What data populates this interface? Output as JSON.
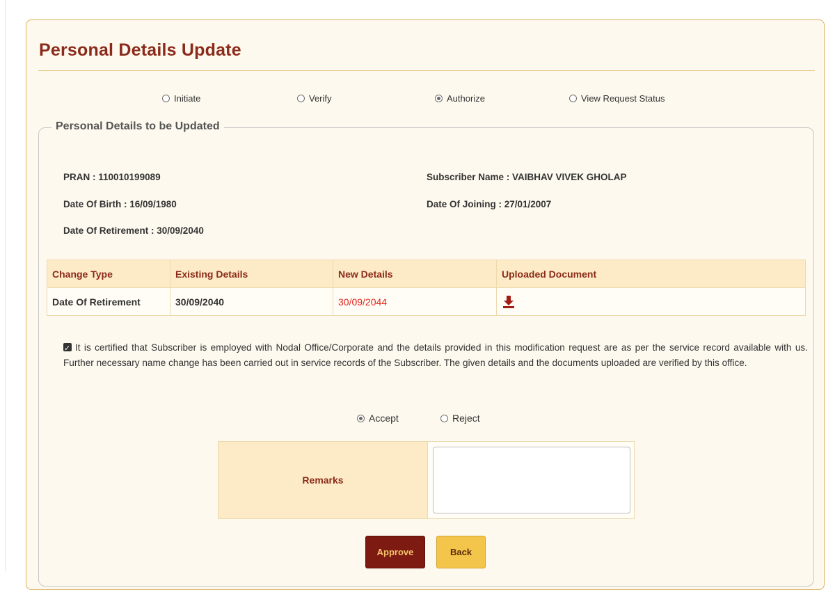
{
  "page": {
    "title": "Personal Details Update",
    "workflow_options": [
      "Initiate",
      "Verify",
      "Authorize",
      "View Request Status"
    ],
    "workflow_selected": "Authorize",
    "section_legend": "Personal Details to be Updated",
    "subscriber": {
      "pran": "PRAN : 110010199089",
      "name": "Subscriber Name : VAIBHAV VIVEK GHOLAP",
      "dob": "Date Of Birth : 16/09/1980",
      "doj": "Date Of Joining : 27/01/2007",
      "dor": "Date Of Retirement : 30/09/2040"
    },
    "table": {
      "headers": [
        "Change Type",
        "Existing Details",
        "New Details",
        "Uploaded Document"
      ],
      "rows": [
        {
          "change_type": "Date Of Retirement",
          "existing": "30/09/2040",
          "new": "30/09/2044",
          "document_icon": "download-icon"
        }
      ]
    },
    "certification": {
      "checked": true,
      "text": "It is certified that Subscriber is employed with Nodal Office/Corporate and the details provided in this modification request are as per the service record available with us. Further necessary name change has been carried out in service records of the Subscriber. The given details and the documents uploaded are verified by this office."
    },
    "decision": {
      "accept_label": "Accept",
      "reject_label": "Reject",
      "selected": "Accept"
    },
    "remarks": {
      "label": "Remarks",
      "value": ""
    },
    "buttons": {
      "approve": "Approve",
      "back": "Back"
    },
    "colors": {
      "title": "#8b2a1a",
      "new_value": "#e0261c",
      "approve_bg": "#7d1a11",
      "back_bg": "#f4c54b"
    }
  }
}
